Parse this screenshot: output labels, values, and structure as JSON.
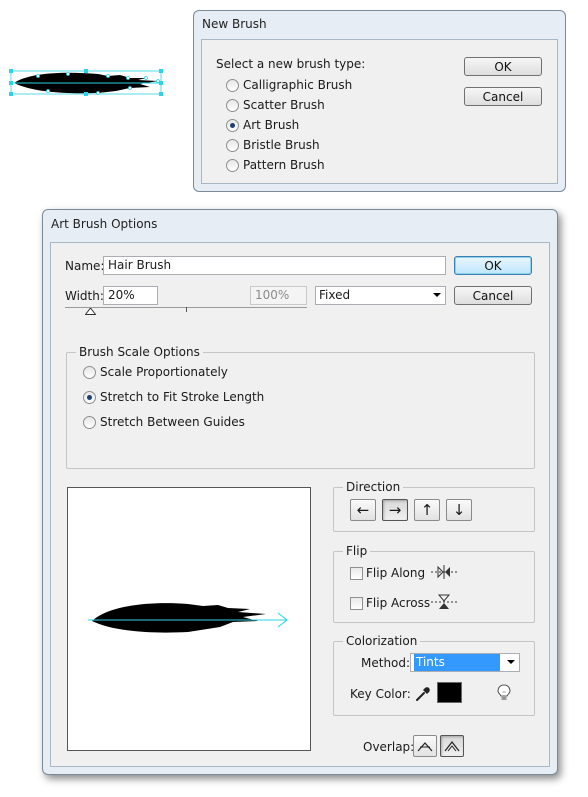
{
  "new_brush": {
    "title": "New Brush",
    "prompt": "Select a new brush type:",
    "options": [
      {
        "label": "Calligraphic Brush",
        "selected": false
      },
      {
        "label": "Scatter Brush",
        "selected": false
      },
      {
        "label": "Art Brush",
        "selected": true
      },
      {
        "label": "Bristle Brush",
        "selected": false
      },
      {
        "label": "Pattern Brush",
        "selected": false
      }
    ],
    "ok_label": "OK",
    "cancel_label": "Cancel"
  },
  "art_brush": {
    "title": "Art Brush Options",
    "name_label": "Name:",
    "name_value": "Hair Brush",
    "width_label": "Width:",
    "width_value": "20%",
    "width_max": "100%",
    "width_mode": "Fixed",
    "ok_label": "OK",
    "cancel_label": "Cancel",
    "scale": {
      "title": "Brush Scale Options",
      "options": [
        {
          "label": "Scale Proportionately",
          "selected": false
        },
        {
          "label": "Stretch to Fit Stroke Length",
          "selected": true
        },
        {
          "label": "Stretch Between Guides",
          "selected": false
        }
      ]
    },
    "direction": {
      "title": "Direction",
      "buttons": [
        {
          "icon": "arrow-left-icon",
          "glyph": "←",
          "pressed": false
        },
        {
          "icon": "arrow-right-icon",
          "glyph": "→",
          "pressed": true
        },
        {
          "icon": "arrow-up-icon",
          "glyph": "↑",
          "pressed": false
        },
        {
          "icon": "arrow-down-icon",
          "glyph": "↓",
          "pressed": false
        }
      ]
    },
    "flip": {
      "title": "Flip",
      "along_label": "Flip Along",
      "along_checked": false,
      "across_label": "Flip Across",
      "across_checked": false
    },
    "colorization": {
      "title": "Colorization",
      "method_label": "Method:",
      "method_value": "Tints",
      "key_color_label": "Key Color:",
      "key_color": "#000000"
    },
    "overlap_label": "Overlap:"
  },
  "colors": {
    "accent": "#3399ff",
    "guide_cyan": "#2ad4e4",
    "artwork": "#000000"
  }
}
